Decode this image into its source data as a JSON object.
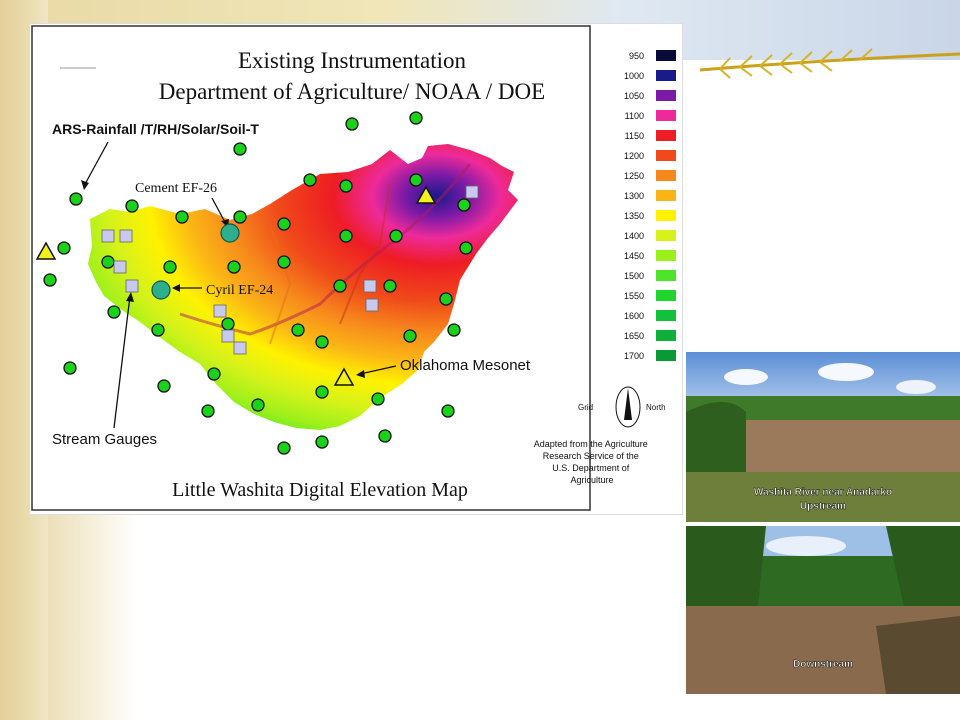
{
  "map": {
    "title_line1": "Existing Instrumentation",
    "title_line2": "Department of Agriculture/ NOAA / DOE",
    "footer_title": "Little Washita Digital Elevation Map",
    "labels": {
      "ars": "ARS-Rainfall /T/RH/Solar/Soil-T",
      "cement": "Cement EF-26",
      "cyril": "Cyril EF-24",
      "mesonet": "Oklahoma Mesonet",
      "stream_gauges": "Stream Gauges"
    },
    "compass": {
      "left": "Grid",
      "right": "North"
    },
    "credit": [
      "Adapted from the Agriculture",
      "Research Service of the",
      "U.S. Department of",
      "Agriculture"
    ]
  },
  "legend": {
    "entries": [
      {
        "label": "950",
        "color": "#0b0b3a"
      },
      {
        "label": "1000",
        "color": "#1a1a8a"
      },
      {
        "label": "1050",
        "color": "#7a1aa6"
      },
      {
        "label": "1100",
        "color": "#ee2a9a"
      },
      {
        "label": "1150",
        "color": "#ee1c24"
      },
      {
        "label": "1200",
        "color": "#f04a1a"
      },
      {
        "label": "1250",
        "color": "#f7891c"
      },
      {
        "label": "1300",
        "color": "#fbb416"
      },
      {
        "label": "1350",
        "color": "#fff200"
      },
      {
        "label": "1400",
        "color": "#d6f21a"
      },
      {
        "label": "1450",
        "color": "#9cf01a"
      },
      {
        "label": "1500",
        "color": "#4ce52a"
      },
      {
        "label": "1550",
        "color": "#1ed62e"
      },
      {
        "label": "1600",
        "color": "#12c13a"
      },
      {
        "label": "1650",
        "color": "#0eb03a"
      },
      {
        "label": "1700",
        "color": "#0a9a34"
      }
    ]
  },
  "photos": {
    "upstream_caption_1": "Washita River near Anadarko",
    "upstream_caption_2": "Upstream",
    "downstream_caption": "Downstream"
  },
  "colors": {
    "station_green": "#19d219",
    "gauge_square": "#c7c9ee",
    "mesonet_yellow": "#f2f21a",
    "ef_site": "#2fae8e"
  }
}
